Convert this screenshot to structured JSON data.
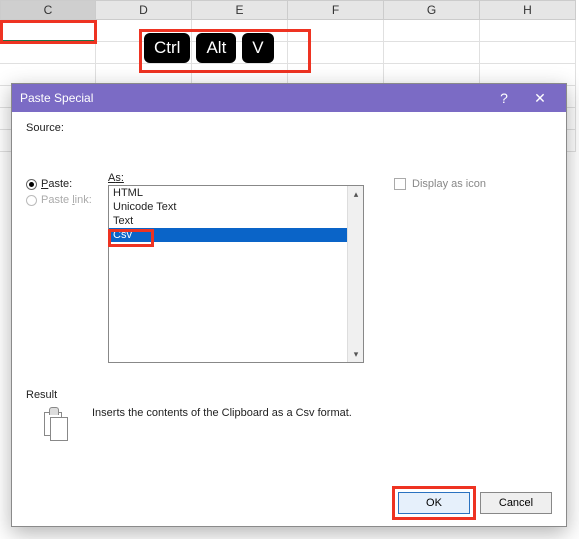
{
  "columns": [
    "C",
    "D",
    "E",
    "F",
    "G",
    "H"
  ],
  "active_column": "C",
  "keys": [
    "Ctrl",
    "Alt",
    "V"
  ],
  "dialog": {
    "title": "Paste Special",
    "help_glyph": "?",
    "close_glyph": "✕",
    "source_label": "Source:",
    "paste_label": "Paste:",
    "paste_link_label": "Paste link:",
    "as_label_underline": "A",
    "as_label_rest": "s:",
    "list": [
      "HTML",
      "Unicode Text",
      "Text",
      "Csv"
    ],
    "selected_index": 3,
    "display_as_icon": "Display as icon",
    "result_label": "Result",
    "result_text": "Inserts the contents of the Clipboard as a Csv format.",
    "ok": "OK",
    "cancel": "Cancel"
  }
}
